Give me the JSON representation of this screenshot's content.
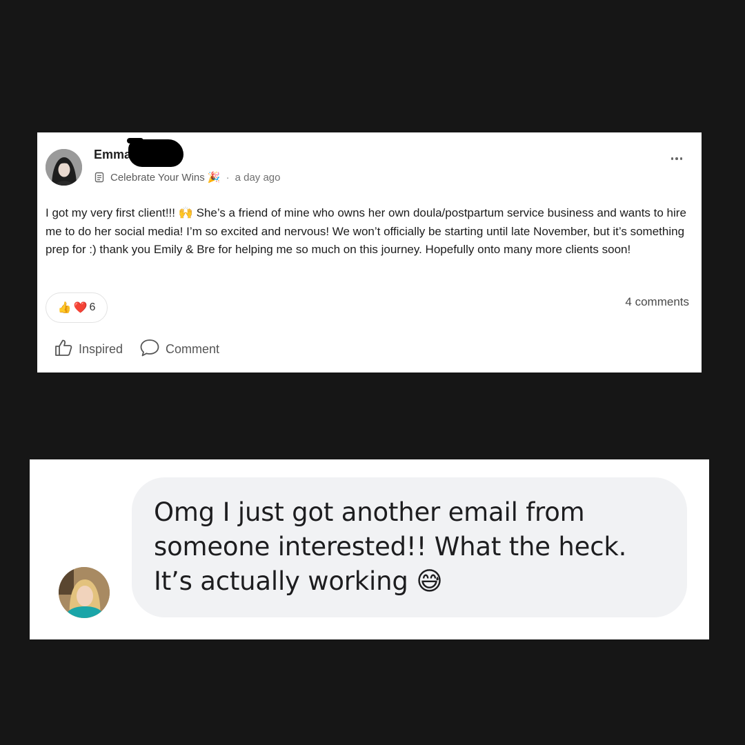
{
  "post": {
    "author": "Emma",
    "category": "Celebrate Your Wins 🎉",
    "separator": "·",
    "time": "a day ago",
    "body": "I got my very first client!!! 🙌 She’s a friend of mine who owns her own doula/postpartum service business and wants to hire me to do her social media! I’m so excited and nervous! We won’t officially be starting until late November, but it’s something prep for :) thank you Emily & Bre for helping me so much on this journey. Hopefully onto many more clients soon!",
    "reactions": {
      "emoji_1": "👍",
      "emoji_2": "❤️",
      "count": "6"
    },
    "comments_count": "4 comments",
    "actions": {
      "inspired": "Inspired",
      "comment": "Comment"
    }
  },
  "chat": {
    "message": "Omg I just got another email from someone interested!! What the heck. It’s actually working 😅"
  },
  "colors": {
    "background": "#161616",
    "card": "#ffffff",
    "bubble": "#f1f2f4"
  }
}
